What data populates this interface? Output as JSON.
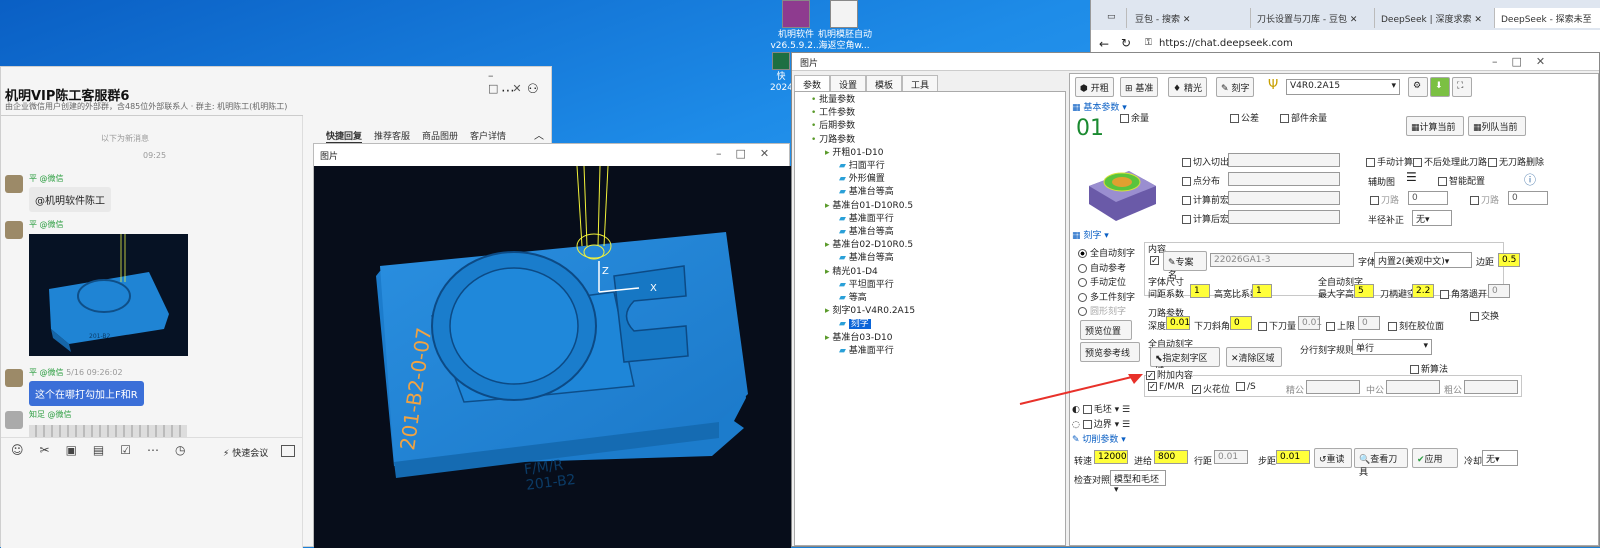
{
  "desktop": {
    "icons": [
      {
        "label": "机明软件\nv26.5.9.2..."
      },
      {
        "label": "机明模胚自动\n海返空角w..."
      },
      {
        "label": "快\n2024..."
      }
    ]
  },
  "chat": {
    "title": "机明VIP陈工客服群6",
    "subtitle": "由企业微信用户创建的外部群，含485位外部联系人 · 群主: 机明陈工(机明陈工)",
    "divider": "以下为新消息",
    "time": "09:25",
    "tabs": [
      "快捷回复",
      "推荐客服",
      "商品图册",
      "客户详情"
    ],
    "messages": [
      {
        "name": "平 @微信",
        "text": "@机明软件陈工"
      },
      {
        "name": "平 @微信",
        "text": ""
      },
      {
        "name": "平 @微信",
        "time": "5/16 09:26:02",
        "text": "这个在哪打勾加上F和R"
      },
      {
        "name": "知足 @微信",
        "text": ""
      }
    ],
    "toolbar": {
      "meeting": "快速会议"
    }
  },
  "viewer": {
    "title": "图片",
    "axis_z": "Z",
    "axis_x": "X",
    "side_text": "201-B2-0-07",
    "part_text1": "F/M/R",
    "part_text2": "201-B2"
  },
  "browser": {
    "tabs": [
      "豆包 - 搜索",
      "刀长设置与刀库 - 豆包",
      "DeepSeek | 深度求索",
      "DeepSeek - 探索未至"
    ],
    "url": "https://chat.deepseek.com"
  },
  "cam": {
    "title": "图片",
    "tabs": [
      "参数",
      "设置",
      "模板",
      "工具"
    ],
    "tree": [
      {
        "label": "批量参数",
        "level": 0
      },
      {
        "label": "工件参数",
        "level": 0
      },
      {
        "label": "后期参数",
        "level": 0
      },
      {
        "label": "刀路参数",
        "level": 0
      },
      {
        "label": "开粗01-D10",
        "level": 1
      },
      {
        "label": "扫面平行",
        "level": 2
      },
      {
        "label": "外形偏置",
        "level": 2
      },
      {
        "label": "基准台等高",
        "level": 2
      },
      {
        "label": "基准台01-D10R0.5",
        "level": 1
      },
      {
        "label": "基准面平行",
        "level": 2
      },
      {
        "label": "基准台等高",
        "level": 2
      },
      {
        "label": "基准台02-D10R0.5",
        "level": 1
      },
      {
        "label": "基准台等高",
        "level": 2
      },
      {
        "label": "精光01-D4",
        "level": 1
      },
      {
        "label": "平坦面平行",
        "level": 2
      },
      {
        "label": "等高",
        "level": 2
      },
      {
        "label": "刻字01-V4R0.2A15",
        "level": 1
      },
      {
        "label": "刻字",
        "level": 2,
        "selected": true
      },
      {
        "label": "基准台03-D10",
        "level": 1
      },
      {
        "label": "基准面平行",
        "level": 2
      }
    ],
    "toolbar": {
      "kaicu": "开粗",
      "jizhun": "基准",
      "jingguang": "精光",
      "kezi": "刻字",
      "tool": "V4R0.2A15"
    },
    "basic": {
      "section": "基本参数",
      "num": "01",
      "yuliang": "余量",
      "gongcha": "公差",
      "bujianyuliang": "部件余量",
      "calc_current": "计算当前",
      "queue_current": "列队当前",
      "qieru": "切入切出",
      "dianfenbu": "点分布",
      "jisuanqian": "计算前宏",
      "jisuanhou": "计算后宏",
      "manual_calc": "手动计算",
      "no_back": "不后处理此刀路",
      "no_delete": "无刀路删除",
      "aux": "辅助图",
      "smart": "智能配置",
      "halfbu": "半径补正",
      "halfbu_val": "无",
      "zero1": "0",
      "zero2": "0",
      "cut_label1": "刀路",
      "cut_label2": "刀路"
    },
    "kezi": {
      "section": "刻字",
      "modes": [
        "全自动刻字",
        "自动参考",
        "手动定位",
        "多工件刻字",
        "圆形刻字"
      ],
      "content_label": "内容",
      "zhuanan": "专案名",
      "code": "22026GA1-3",
      "font_label": "字体",
      "font_val": "内置2(美观中文)",
      "margin_label": "边距",
      "margin_val": "0.5",
      "size_label": "字体尺寸",
      "spacing_label": "间距系数",
      "spacing_val": "1",
      "ratio_label": "高宽比系数",
      "ratio_val": "1",
      "auto_label": "全自动刻字",
      "maxh_label": "最大字高",
      "maxh_val": "5",
      "avoid_label": "刀柄避空",
      "avoid_val": "2.2",
      "corner_label": "角落遗开",
      "corner_val": "0",
      "path_label": "刀路参数",
      "depth_label": "深度",
      "depth_val": "0.01",
      "ramp_label": "下刀斜角",
      "ramp_val": "0",
      "down_label": "下刀量",
      "down_val": "0.01",
      "up_label": "上限",
      "up_val": "0",
      "glue_label": "刻在胶位面",
      "preview_pos": "预览位置",
      "preview_ref": "预览参考线",
      "auto2_label": "全自动刻字",
      "specify": "指定刻字区域",
      "clear": "清除区域",
      "split_label": "分行刻字规则",
      "split_val": "单行",
      "swap": "交换",
      "newalg": "新算法",
      "extra_label": "附加内容",
      "fmr": "F/M/R",
      "spark": "火花位",
      "slash": "/S",
      "jigong": "精公",
      "zhonggong": "中公",
      "cugong": "粗公"
    },
    "other": {
      "maopei": "毛坯",
      "bianjie": "边界",
      "cut_section": "切削参数",
      "speed_label": "转速",
      "speed_val": "12000",
      "feed_label": "进给",
      "feed_val": "800",
      "step_label": "行距",
      "step_val": "0.01",
      "stepdown_label": "步距",
      "stepdown_val": "0.01",
      "reset": "重读",
      "view_tool": "查看刀具",
      "apply": "应用",
      "cool_label": "冷却",
      "cool_val": "无",
      "check_label": "检查对照",
      "check_val": "模型和毛坯"
    }
  }
}
